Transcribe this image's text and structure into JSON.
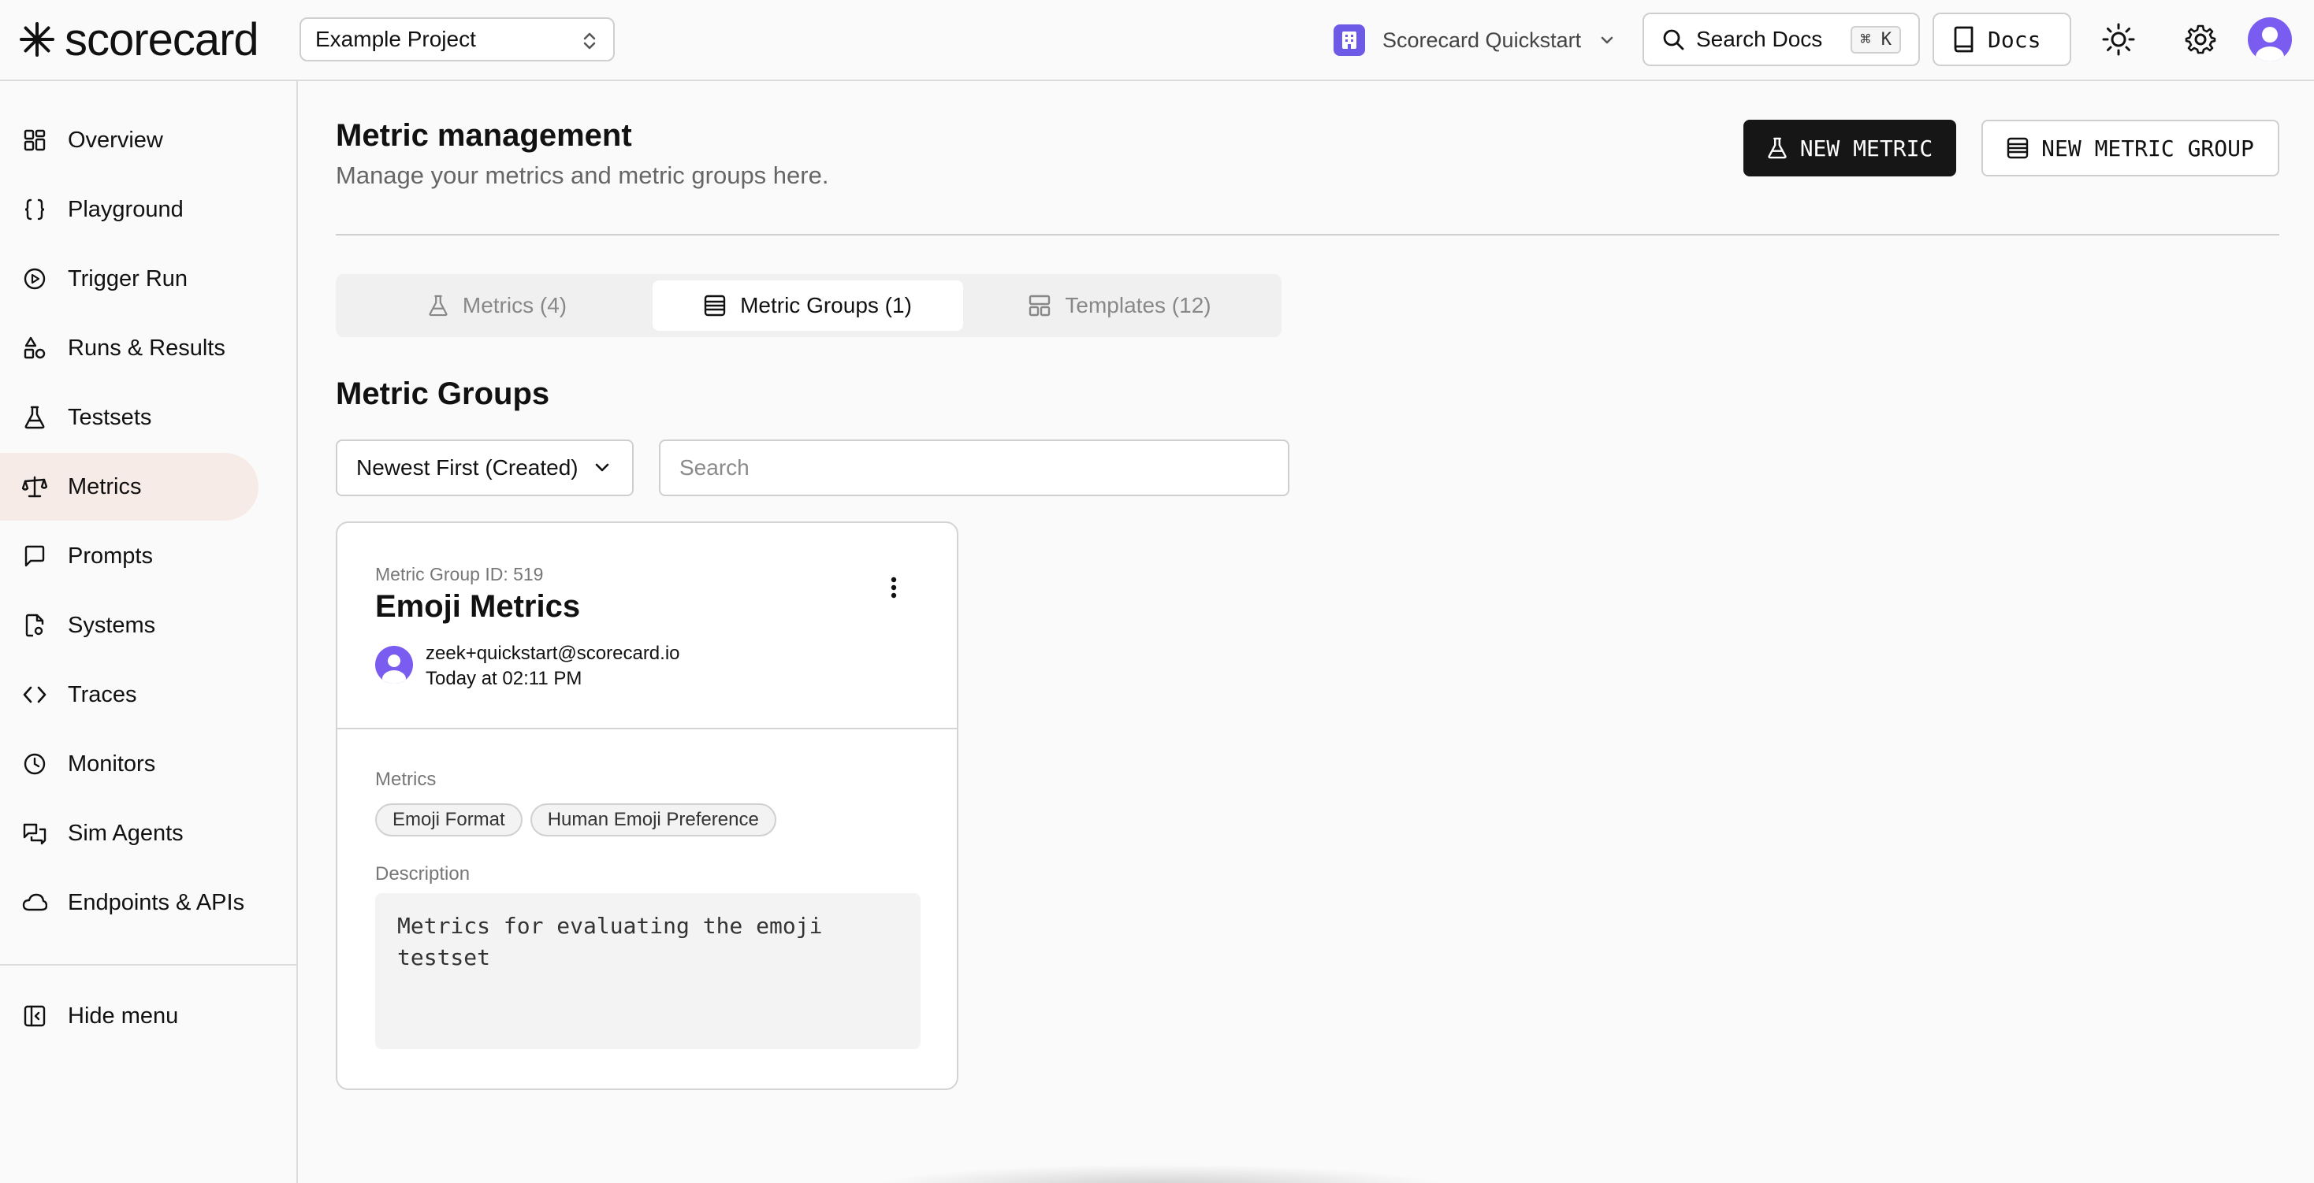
{
  "header": {
    "logo_text": "scorecard",
    "project": "Example Project",
    "org_name": "Scorecard Quickstart",
    "search_label": "Search Docs",
    "search_shortcut": "⌘ K",
    "docs_label": "Docs"
  },
  "sidebar": {
    "items": [
      {
        "label": "Overview",
        "icon": "grid-icon"
      },
      {
        "label": "Playground",
        "icon": "braces-icon"
      },
      {
        "label": "Trigger Run",
        "icon": "play-circle-icon"
      },
      {
        "label": "Runs & Results",
        "icon": "shapes-icon"
      },
      {
        "label": "Testsets",
        "icon": "flask-icon"
      },
      {
        "label": "Metrics",
        "icon": "scale-icon",
        "active": true
      },
      {
        "label": "Prompts",
        "icon": "message-square-icon"
      },
      {
        "label": "Systems",
        "icon": "file-cog-icon"
      },
      {
        "label": "Traces",
        "icon": "code-icon"
      },
      {
        "label": "Monitors",
        "icon": "clock-icon"
      },
      {
        "label": "Sim Agents",
        "icon": "messages-icon"
      },
      {
        "label": "Endpoints & APIs",
        "icon": "cloud-icon"
      }
    ],
    "hide_menu": "Hide menu"
  },
  "main": {
    "title": "Metric management",
    "subtitle": "Manage your metrics and metric groups here.",
    "new_metric": "NEW METRIC",
    "new_metric_group": "NEW METRIC GROUP",
    "tabs": [
      {
        "label": "Metrics (4)"
      },
      {
        "label": "Metric Groups (1)",
        "active": true
      },
      {
        "label": "Templates (12)"
      }
    ],
    "section_title": "Metric Groups",
    "sort_value": "Newest First (Created)",
    "search_placeholder": "Search",
    "card": {
      "group_id": "Metric Group ID: 519",
      "name": "Emoji Metrics",
      "owner_email": "zeek+quickstart@scorecard.io",
      "created": "Today at 02:11 PM",
      "metrics_label": "Metrics",
      "metrics": [
        "Emoji Format",
        "Human Emoji Preference"
      ],
      "description_label": "Description",
      "description": "Metrics for evaluating the emoji testset"
    }
  },
  "colors": {
    "accent_purple": "#7a5cf0",
    "active_nav_bg": "#f7ebe7",
    "primary_button": "#161616"
  }
}
